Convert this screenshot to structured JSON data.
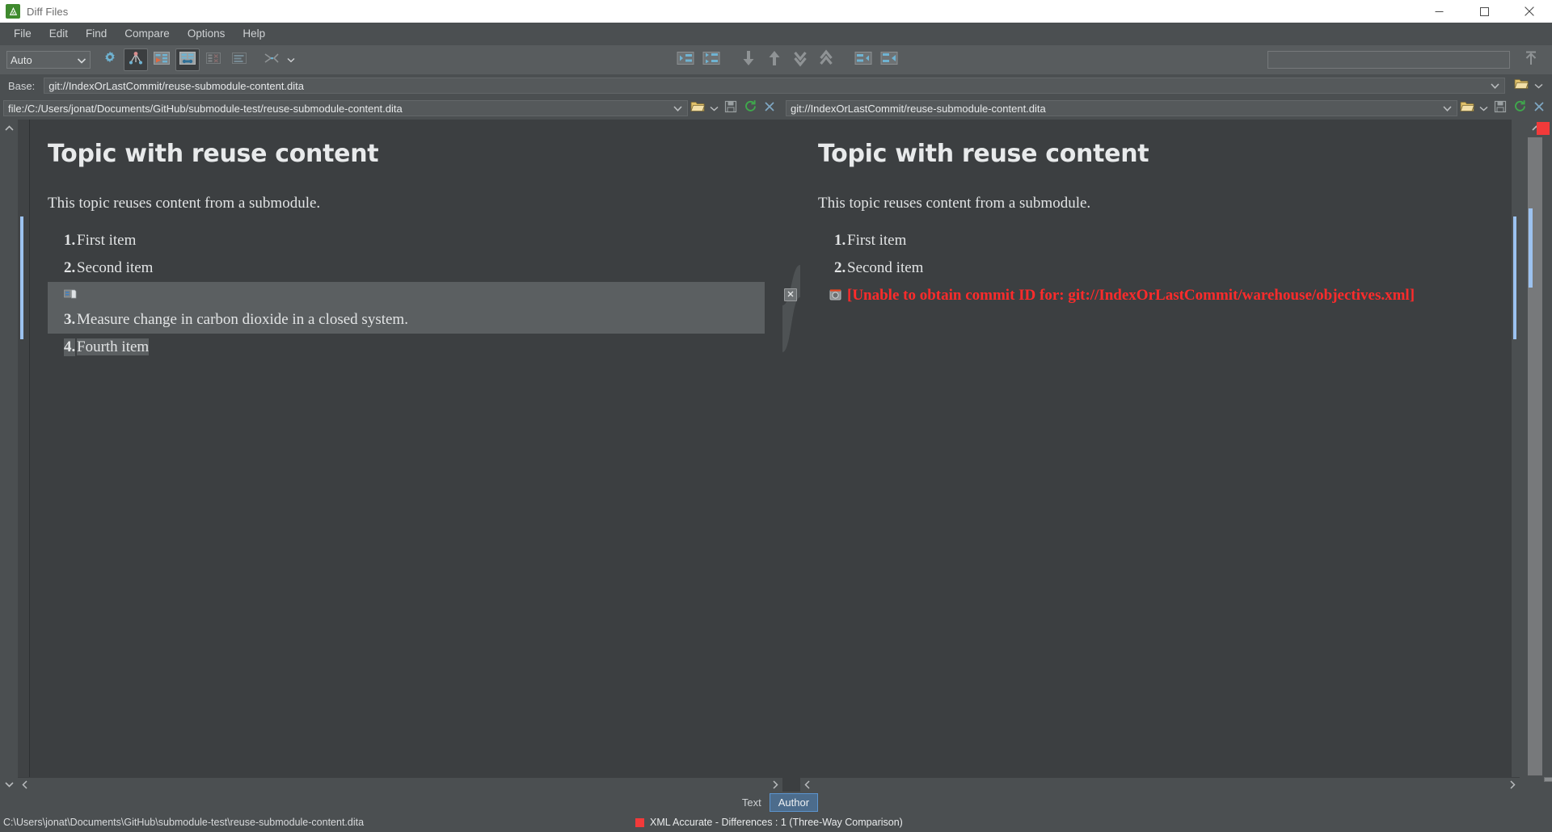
{
  "window": {
    "title": "Diff Files",
    "app_icon": "oxygen-diff-icon",
    "minimize": "minimize-icon",
    "maximize": "maximize-icon",
    "close": "close-icon"
  },
  "menubar": {
    "items": [
      {
        "label": "File"
      },
      {
        "label": "Edit"
      },
      {
        "label": "Find"
      },
      {
        "label": "Compare"
      },
      {
        "label": "Options"
      },
      {
        "label": "Help"
      }
    ]
  },
  "toolbar": {
    "algorithm_combo": {
      "value": "Auto",
      "chevron": "chevron-down-icon"
    },
    "left_buttons": [
      {
        "name": "diff-options-gear-icon",
        "enabled": true,
        "pressed": false
      },
      {
        "name": "diff-algorithm-icon",
        "enabled": true,
        "pressed": true
      },
      {
        "name": "perform-files-differencing-icon",
        "enabled": true,
        "pressed": false
      },
      {
        "name": "show-modified-blocks-icon",
        "enabled": true,
        "pressed": true
      },
      {
        "name": "ignore-nodes-icon",
        "enabled": false,
        "pressed": false
      },
      {
        "name": "format-and-indent-icon",
        "enabled": false,
        "pressed": false
      },
      {
        "name": "merge-mode-icon",
        "enabled": true,
        "pressed": false
      },
      {
        "name": "merge-mode-dropdown-chevron-icon",
        "enabled": true,
        "pressed": false
      }
    ],
    "center_buttons": [
      {
        "name": "copy-change-to-left-icon"
      },
      {
        "name": "copy-all-changes-to-left-icon"
      },
      {
        "name": "next-difference-icon"
      },
      {
        "name": "previous-difference-icon"
      },
      {
        "name": "last-difference-icon"
      },
      {
        "name": "first-difference-icon"
      },
      {
        "name": "copy-change-to-right-icon"
      },
      {
        "name": "copy-all-changes-to-right-icon"
      }
    ],
    "search_field": {
      "value": "",
      "placeholder": ""
    },
    "right_button": {
      "name": "goto-top-icon"
    }
  },
  "base_row": {
    "label": "Base:",
    "path": "git://IndexOrLastCommit/reuse-submodule-content.dita",
    "chevron": "chevron-down-icon",
    "folder_button": "open-folder-icon",
    "folder_dropdown": "chevron-down-icon"
  },
  "left_pane": {
    "path": "file:/C:/Users/jonat/Documents/GitHub/submodule-test/reuse-submodule-content.dita",
    "chevron": "chevron-down-icon",
    "buttons": [
      {
        "name": "open-folder-icon"
      },
      {
        "name": "folder-history-chevron-icon"
      },
      {
        "name": "save-icon"
      },
      {
        "name": "reload-icon"
      },
      {
        "name": "close-pane-icon"
      }
    ],
    "document": {
      "title": "Topic with reuse content",
      "paragraph": "This topic reuses content from a submodule.",
      "list": [
        {
          "num": "1.",
          "text": "First item",
          "state": "normal"
        },
        {
          "num": "2.",
          "text": "Second item",
          "state": "normal"
        },
        {
          "num": "",
          "text": "",
          "state": "inserted-reuse",
          "icon": "content-reference-icon"
        },
        {
          "num": "3.",
          "text": "Measure change in carbon dioxide in a closed system.",
          "state": "changed"
        },
        {
          "num": "4.",
          "text": "Fourth item",
          "state": "selected"
        }
      ]
    },
    "scroll": {
      "up_arrow": "chevron-up-icon",
      "down_arrow": "chevron-down-icon",
      "left_arrow": "chevron-left-icon",
      "right_arrow": "chevron-right-icon"
    }
  },
  "right_pane": {
    "path": "git://IndexOrLastCommit/reuse-submodule-content.dita",
    "chevron": "chevron-down-icon",
    "buttons": [
      {
        "name": "open-folder-icon"
      },
      {
        "name": "folder-history-chevron-icon"
      },
      {
        "name": "save-icon"
      },
      {
        "name": "reload-icon"
      },
      {
        "name": "close-pane-icon"
      }
    ],
    "document": {
      "title": "Topic with reuse content",
      "paragraph": "This topic reuses content from a submodule.",
      "list": [
        {
          "num": "1.",
          "text": "First item",
          "state": "normal"
        },
        {
          "num": "2.",
          "text": "Second item",
          "state": "normal"
        }
      ],
      "error": {
        "icon": "broken-reference-icon",
        "text": "[Unable to obtain commit ID for: git://IndexOrLastCommit/warehouse/objectives.xml]"
      }
    },
    "scroll": {
      "up_arrow": "chevron-up-icon",
      "down_arrow": "chevron-down-icon",
      "left_arrow": "chevron-left-icon",
      "right_arrow": "chevron-right-icon"
    }
  },
  "connector": {
    "close_diff_button": "close-difference-icon"
  },
  "overview_ruler": {
    "marker_color": "#f23a3a",
    "thumb_color": "#9cc2f0"
  },
  "bottom_tabs": {
    "tabs": [
      {
        "label": "Text",
        "active": false
      },
      {
        "label": "Author",
        "active": true
      }
    ]
  },
  "statusbar": {
    "path": "C:\\Users\\jonat\\Documents\\GitHub\\submodule-test\\reuse-submodule-content.dita",
    "diff_status": "XML Accurate - Differences : 1 (Three-Way Comparison)",
    "diff_status_color": "#f23a3a"
  },
  "colors": {
    "window_chrome": "#4b4f51",
    "toolbar": "#585c5e",
    "editor_bg": "#3c3f41",
    "accent_blue": "#6fb3d2",
    "change_highlight": "#5b5f61",
    "change_bar": "#9cc2f0",
    "error_red": "#ff2b2b"
  }
}
